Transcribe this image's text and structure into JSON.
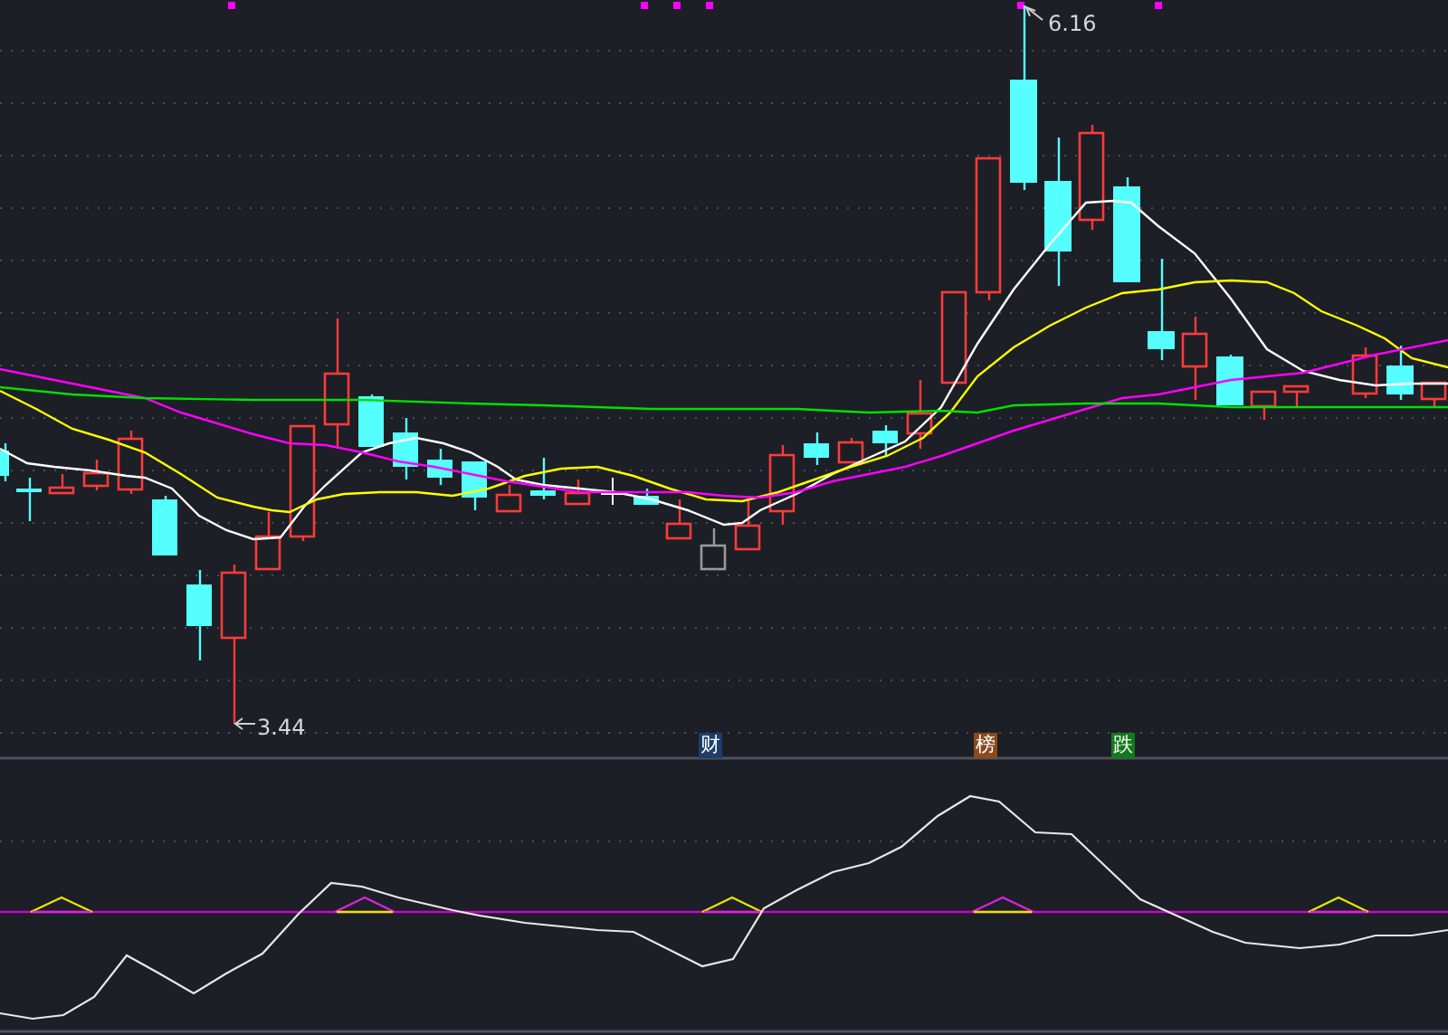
{
  "main_chart": {
    "high_label": "6.16",
    "low_label": "3.44",
    "event_tags": [
      {
        "text": "财",
        "color": "#1d3d6b"
      },
      {
        "text": "榜",
        "color": "#8a4a1e"
      },
      {
        "text": "跌",
        "color": "#137a1b"
      }
    ]
  }
}
